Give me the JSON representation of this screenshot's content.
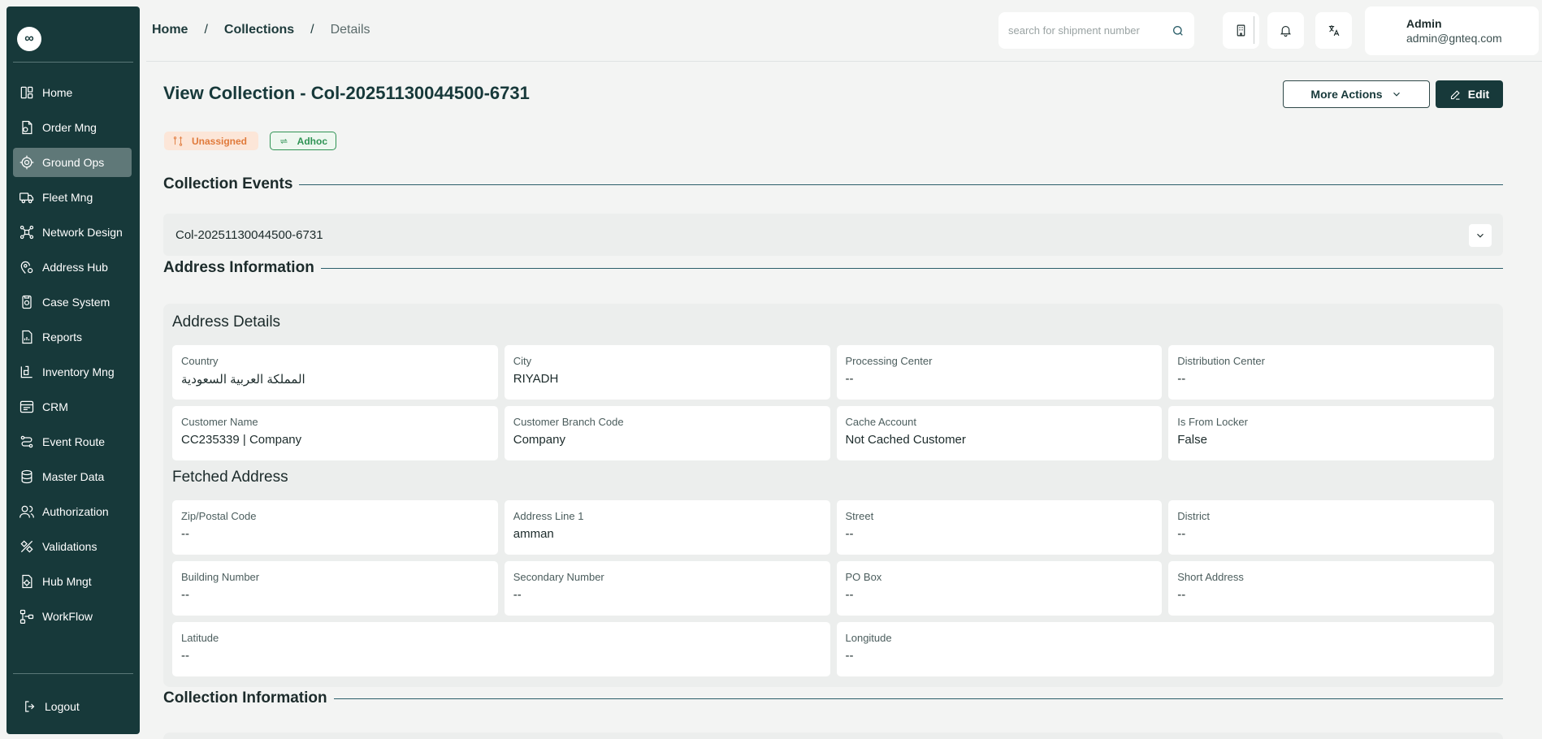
{
  "sidebar": {
    "logo": "∞",
    "items": [
      {
        "label": "Home",
        "icon": "layout-icon"
      },
      {
        "label": "Order Mng",
        "icon": "order-icon"
      },
      {
        "label": "Ground Ops",
        "icon": "ground-ops-icon"
      },
      {
        "label": "Fleet Mng",
        "icon": "truck-icon"
      },
      {
        "label": "Network Design",
        "icon": "network-icon"
      },
      {
        "label": "Address Hub",
        "icon": "map-pin-icon"
      },
      {
        "label": "Case System",
        "icon": "case-icon"
      },
      {
        "label": "Reports",
        "icon": "report-icon"
      },
      {
        "label": "Inventory Mng",
        "icon": "inventory-icon"
      },
      {
        "label": "CRM",
        "icon": "crm-icon"
      },
      {
        "label": "Event Route",
        "icon": "route-icon"
      },
      {
        "label": "Master Data",
        "icon": "database-icon"
      },
      {
        "label": "Authorization",
        "icon": "users-icon"
      },
      {
        "label": "Validations",
        "icon": "validations-icon"
      },
      {
        "label": "Hub Mngt",
        "icon": "hub-icon"
      },
      {
        "label": "WorkFlow",
        "icon": "workflow-icon"
      }
    ],
    "active": "Ground Ops",
    "logout": "Logout"
  },
  "header": {
    "breadcrumb": {
      "home": "Home",
      "sep": "/",
      "collections": "Collections",
      "current": "Details"
    },
    "search_placeholder": "search for shipment number",
    "user": {
      "name": "Admin",
      "email": "admin@gnteq.com"
    }
  },
  "page": {
    "title": "View Collection - Col-20251130044500-6731",
    "more_actions": "More Actions",
    "edit": "Edit",
    "badges": {
      "status": "Unassigned",
      "type": "Adhoc"
    },
    "colors": {
      "primary": "#17393a",
      "status_orange": "#e07a3b",
      "adhoc_green": "#2f9354"
    }
  },
  "collection_events": {
    "heading": "Collection Events",
    "item": "Col-20251130044500-6731"
  },
  "address_information": {
    "heading": "Address Information",
    "details_title": "Address Details",
    "details": [
      {
        "label": "Country",
        "value": "المملكة العربية السعودية"
      },
      {
        "label": "City",
        "value": "RIYADH"
      },
      {
        "label": "Processing Center",
        "value": "--"
      },
      {
        "label": "Distribution Center",
        "value": "--"
      },
      {
        "label": "Customer Name",
        "value": "CC235339 | Company"
      },
      {
        "label": "Customer Branch Code",
        "value": "Company"
      },
      {
        "label": "Cache Account",
        "value": "Not Cached Customer"
      },
      {
        "label": "Is From Locker",
        "value": "False"
      }
    ],
    "fetched_title": "Fetched Address",
    "fetched": [
      {
        "label": "Zip/Postal Code",
        "value": "--"
      },
      {
        "label": "Address Line 1",
        "value": "amman"
      },
      {
        "label": "Street",
        "value": "--"
      },
      {
        "label": "District",
        "value": "--"
      },
      {
        "label": "Building Number",
        "value": "--"
      },
      {
        "label": "Secondary Number",
        "value": "--"
      },
      {
        "label": "PO Box",
        "value": "--"
      },
      {
        "label": "Short Address",
        "value": "--"
      }
    ],
    "coords": [
      {
        "label": "Latitude",
        "value": "--"
      },
      {
        "label": "Longitude",
        "value": "--"
      }
    ]
  },
  "collection_information": {
    "heading": "Collection Information"
  }
}
